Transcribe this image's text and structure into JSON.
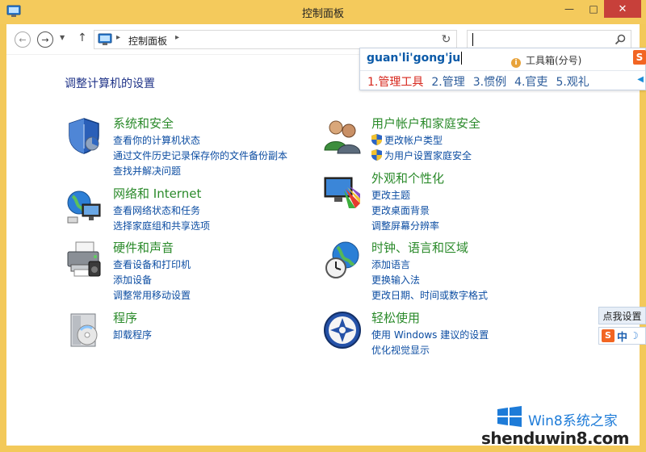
{
  "window": {
    "title": "控制面板",
    "minimize_glyph": "—",
    "maximize_glyph": "□",
    "close_glyph": "✕"
  },
  "navbar": {
    "back_glyph": "←",
    "forward_glyph": "→",
    "recent_glyph": "▼",
    "up_glyph": "↑",
    "address": {
      "separator": "▸",
      "crumb": "控制面板"
    },
    "refresh_glyph": "↻",
    "search": {
      "value": "",
      "placeholder": ""
    }
  },
  "ime": {
    "composition": "guan'li'gong'ju",
    "toolbox": "工具箱(分号)",
    "toolbox_icon": "i",
    "logo": "S",
    "candidates": [
      "1.管理工具",
      "2.管理",
      "3.惯例",
      "4.官吏",
      "5.观礼"
    ],
    "scroll_glyph": "◀"
  },
  "main": {
    "heading": "调整计算机的设置",
    "categories": [
      {
        "title": "系统和安全",
        "icon": "shield-icon",
        "links": [
          "查看你的计算机状态",
          "通过文件历史记录保存你的文件备份副本",
          "查找并解决问题"
        ]
      },
      {
        "title": "网络和 Internet",
        "icon": "network-globe-icon",
        "links": [
          "查看网络状态和任务",
          "选择家庭组和共享选项"
        ]
      },
      {
        "title": "硬件和声音",
        "icon": "printer-icon",
        "links": [
          "查看设备和打印机",
          "添加设备",
          "调整常用移动设置"
        ]
      },
      {
        "title": "程序",
        "icon": "programs-box-icon",
        "links": [
          "卸载程序"
        ]
      },
      {
        "title": "用户帐户和家庭安全",
        "icon": "users-icon",
        "links": [
          "更改帐户类型",
          "为用户设置家庭安全"
        ]
      },
      {
        "title": "外观和个性化",
        "icon": "display-palette-icon",
        "links": [
          "更改主题",
          "更改桌面背景",
          "调整屏幕分辨率"
        ]
      },
      {
        "title": "时钟、语言和区域",
        "icon": "clock-globe-icon",
        "links": [
          "添加语言",
          "更换输入法",
          "更改日期、时间或数字格式"
        ]
      },
      {
        "title": "轻松使用",
        "icon": "ease-of-access-icon",
        "links": [
          "使用 Windows 建议的设置",
          "优化视觉显示"
        ]
      }
    ]
  },
  "ime_tip": "点我设置",
  "ime_status": {
    "logo": "S",
    "lang": "中",
    "mode_glyph": "☽"
  },
  "watermark": {
    "brand": "Win8系统之家",
    "url": "shenduwin8.com"
  },
  "colors": {
    "title_bar": "#f4ca5c",
    "close_button": "#c7403a",
    "category_title": "#2a8a2a",
    "link": "#0c4da2",
    "heading": "#1e3287",
    "ime_candidate_first": "#d6261c"
  }
}
